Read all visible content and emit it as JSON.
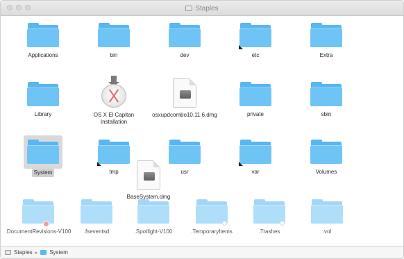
{
  "window": {
    "title": "Staples"
  },
  "items": [
    {
      "label": "Applications"
    },
    {
      "label": "bin"
    },
    {
      "label": "dev"
    },
    {
      "label": "etc"
    },
    {
      "label": "Extra"
    },
    {
      "label": "Library"
    },
    {
      "label": "OS X El Capitan Installation"
    },
    {
      "label": "osxupdcombo10.11.6.dmg"
    },
    {
      "label": "private"
    },
    {
      "label": "sbin"
    },
    {
      "label": "System"
    },
    {
      "label": "tmp"
    },
    {
      "label": "BaseSystem.dmg"
    },
    {
      "label": "usr"
    },
    {
      "label": "var"
    },
    {
      "label": "Volumes"
    },
    {
      "label": ".DocumentRevisions-V100"
    },
    {
      "label": ".fseventsd"
    },
    {
      "label": ".Spotlight-V100"
    },
    {
      "label": ".TemporaryItems"
    },
    {
      "label": ".Trashes"
    },
    {
      "label": ".vol"
    }
  ],
  "pathbar": {
    "disk": "Staples",
    "separator": "▸",
    "folder": "System"
  },
  "colors": {
    "folder": "#58b6f0",
    "folder_front": "#6fc4f6",
    "selection": "#d9d9d9"
  }
}
